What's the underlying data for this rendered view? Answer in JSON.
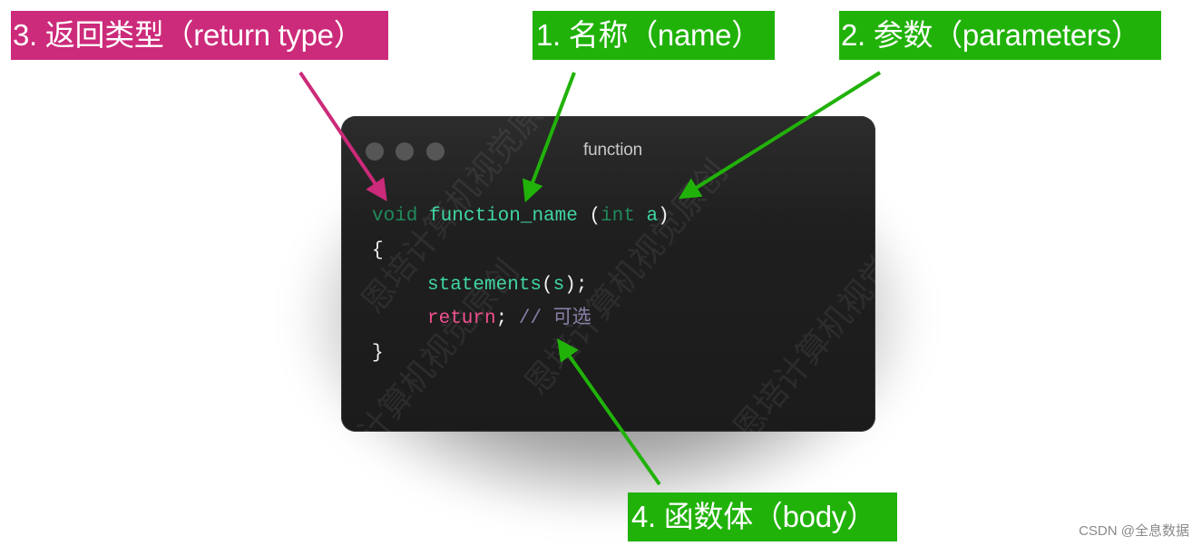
{
  "labels": {
    "return_type": "3. 返回类型（return type）",
    "name": "1. 名称（name）",
    "parameters": "2. 参数（parameters）",
    "body": "4. 函数体（body）"
  },
  "colors": {
    "pink_label": "#cc2a7a",
    "green_label": "#21b20a",
    "window_bg": "#1c1c1c",
    "keyword": "#1f8a5a",
    "identifier": "#3fd6a0",
    "return_keyword": "#f0508f",
    "comment": "#8a7fa8"
  },
  "window": {
    "title": "function",
    "code": {
      "line1": {
        "type": "void",
        "name": "function_name",
        "open_paren": " (",
        "param_type": "int",
        "param_name": "a",
        "close_paren": ")"
      },
      "line2": {
        "brace": "{"
      },
      "line3": {
        "call": "statements",
        "open": "(",
        "arg": "s",
        "close": ");"
      },
      "line4": {
        "keyword": "return",
        "semicolon": ";",
        "comment": "// 可选"
      },
      "line5": {
        "brace": "}"
      }
    },
    "watermark": "恩培计算机视觉原创"
  },
  "footer": {
    "credit": "CSDN @全息数据"
  }
}
